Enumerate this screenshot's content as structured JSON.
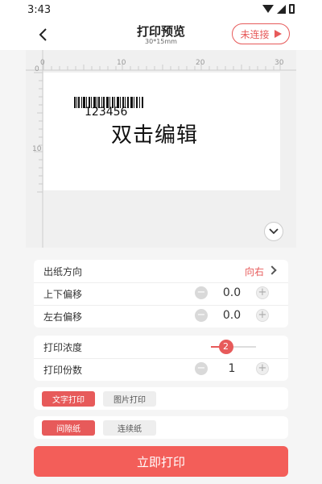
{
  "status": {
    "time": "3:43"
  },
  "header": {
    "title": "打印预览",
    "subtitle": "30*15mm",
    "connect_label": "未连接"
  },
  "ruler": {
    "top_labels": [
      "0",
      "10",
      "20",
      "30"
    ],
    "left_labels": [
      "0",
      "10"
    ]
  },
  "label": {
    "barcode_text": "123456",
    "main_text": "双击编辑"
  },
  "settings": {
    "paper_direction": {
      "label": "出纸方向",
      "value": "向右"
    },
    "vertical_offset": {
      "label": "上下偏移",
      "value": "0.0",
      "minus": "−",
      "plus": "+"
    },
    "horizontal_offset": {
      "label": "左右偏移",
      "value": "0.0",
      "minus": "−",
      "plus": "+"
    }
  },
  "print": {
    "density": {
      "label": "打印浓度",
      "value": 2,
      "min": 1,
      "max": 5
    },
    "copies": {
      "label": "打印份数",
      "value": "1",
      "minus": "−",
      "plus": "+"
    }
  },
  "print_mode": {
    "options": [
      "文字打印",
      "图片打印"
    ],
    "selected": 0
  },
  "paper_type": {
    "options": [
      "间隙纸",
      "连续纸"
    ],
    "selected": 0
  },
  "actions": {
    "print_now": "立即打印"
  },
  "colors": {
    "accent": "#e75a5a",
    "button": "#f35e59"
  },
  "icons": {
    "back": "chevron-left-icon",
    "connect": "play-icon",
    "expand": "chevron-down-icon",
    "direction": "chevron-right-icon"
  }
}
